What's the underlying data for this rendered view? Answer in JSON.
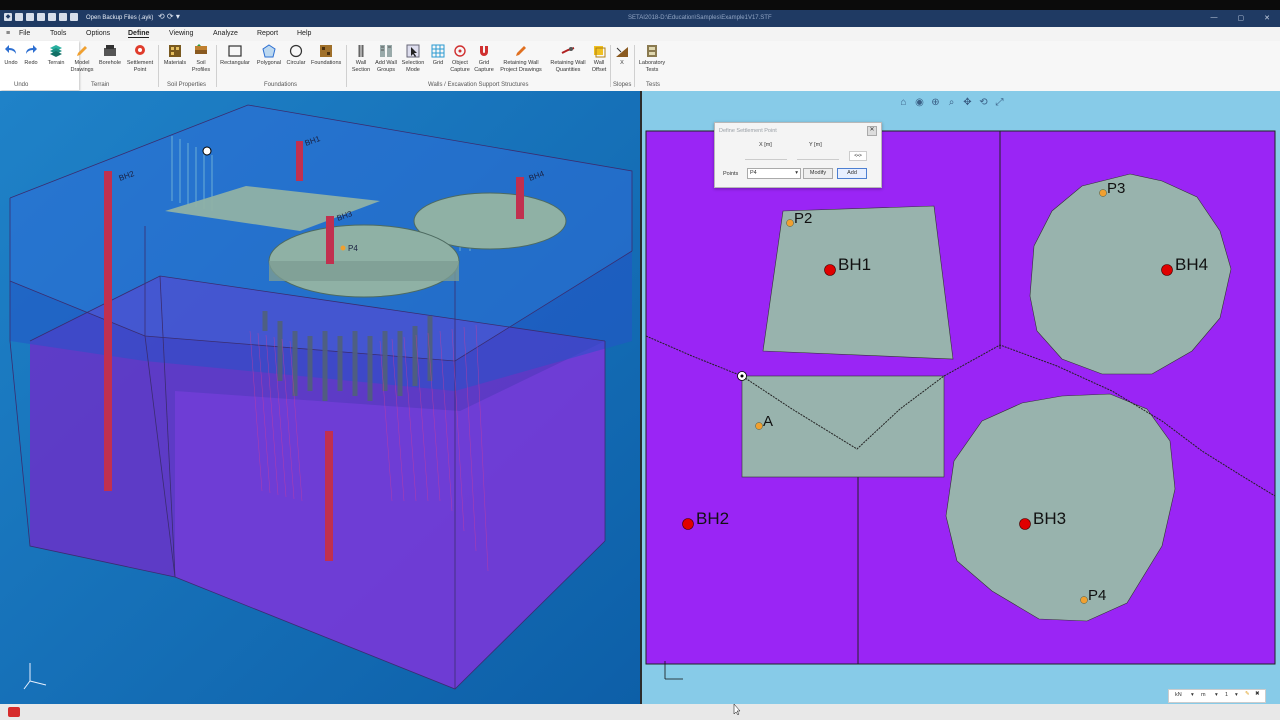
{
  "title_bar": {
    "app_name": "Open Backup Files (.ayk)",
    "file_title": "SETAI2018-D:\\Education\\Samples\\Example1V17.STF",
    "controls": [
      "—",
      "▢",
      "✕"
    ]
  },
  "menu": {
    "items": [
      "File",
      "Tools",
      "Options",
      "Define",
      "Viewing",
      "Analyze",
      "Report",
      "Help"
    ],
    "active": "Define"
  },
  "ribbon": {
    "buttons": [
      {
        "label": "Undo",
        "icon": "undo-icon"
      },
      {
        "label": "Redo",
        "icon": "redo-icon"
      },
      {
        "label": "Terrain",
        "icon": "terrain-icon"
      },
      {
        "label": "Model\nDrawings",
        "icon": "pencil-icon"
      },
      {
        "label": "Borehole",
        "icon": "borehole-icon"
      },
      {
        "label": "Settlement\nPoint",
        "icon": "settlement-point-icon"
      },
      {
        "label": "Materials",
        "icon": "materials-icon"
      },
      {
        "label": "Soil\nProfiles",
        "icon": "soil-profiles-icon"
      },
      {
        "label": "Rectangular",
        "icon": "rectangle-icon"
      },
      {
        "label": "Polygonal",
        "icon": "polygon-icon"
      },
      {
        "label": "Circular",
        "icon": "circle-icon"
      },
      {
        "label": "Foundations",
        "icon": "foundations-icon"
      },
      {
        "label": "Wall\nSection",
        "icon": "wall-section-icon"
      },
      {
        "label": "Add Wall\nGroups",
        "icon": "wall-groups-icon"
      },
      {
        "label": "Selection\nMode",
        "icon": "cursor-icon"
      },
      {
        "label": "Grid",
        "icon": "grid-icon"
      },
      {
        "label": "Object\nCapture",
        "icon": "object-capture-icon"
      },
      {
        "label": "Grid\nCapture",
        "icon": "magnet-icon"
      },
      {
        "label": "Retaining Wall\nProject Drawings",
        "icon": "pen-icon"
      },
      {
        "label": "Retaining Wall\nQuantities",
        "icon": "quantities-icon"
      },
      {
        "label": "Wall\nOffset",
        "icon": "offset-icon"
      },
      {
        "label": "X",
        "icon": "slopes-icon"
      },
      {
        "label": "Laboratory\nTests",
        "icon": "lab-tests-icon"
      }
    ],
    "groups": [
      "Undo",
      "Terrain",
      "Soil Properties",
      "Foundations",
      "Walls / Excavation Support Structures",
      "Slopes",
      "Tests"
    ]
  },
  "dialog": {
    "title": "Define Settlement Point",
    "x_label": "X [m]",
    "y_label": "Y [m]",
    "x_value": "",
    "y_value": "",
    "pick_label": "<•>",
    "points_label": "Points",
    "points_selected": "P4",
    "modify_label": "Modify",
    "add_label": "Add"
  },
  "plan_view": {
    "boreholes": [
      {
        "label": "BH1"
      },
      {
        "label": "BH2"
      },
      {
        "label": "BH3"
      },
      {
        "label": "BH4"
      }
    ],
    "settlement_points": [
      {
        "label": "P2"
      },
      {
        "label": "P3"
      },
      {
        "label": "P4"
      },
      {
        "label": "A"
      }
    ],
    "colors": {
      "background": "#87cbe8",
      "ground": "#9a25f5",
      "foundation": "#98b3ad",
      "borehole": "#e00000",
      "point": "#f0a030"
    }
  },
  "model_3d": {
    "labels": [
      "BH1",
      "BH2",
      "BH3",
      "BH4",
      "P4"
    ]
  },
  "status": {
    "units": [
      "kN",
      "m",
      "1"
    ]
  }
}
